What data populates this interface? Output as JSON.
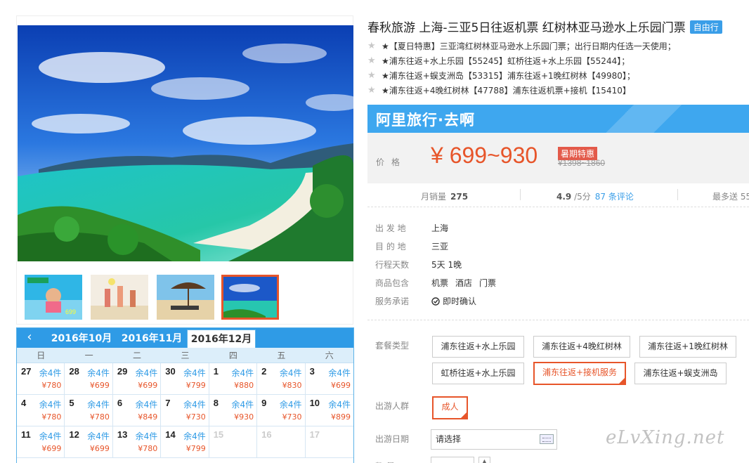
{
  "product": {
    "title": "春秋旅游 上海-三亚5日往返机票 红树林亚马逊水上乐园门票",
    "tag": "自由行",
    "highlights": [
      "★【夏日特惠】三亚湾红树林亚马逊水上乐园门票；出行日期内任选一天使用；",
      "★浦东往返+水上乐园【55245】虹桥往返+水上乐园【55244】；",
      "★浦东往返+蜈支洲岛【53315】浦东往返+1晚红树林【49980】；",
      "★浦东往返+4晚红树林【47788】浦东往返机票+接机【15410】"
    ]
  },
  "brand": {
    "text": "阿里旅行·去啊"
  },
  "price": {
    "label": "价格",
    "value": "¥ 699~930",
    "promo": "暑期特惠",
    "original": "¥1398~1860"
  },
  "stats": {
    "monthly_sales_label": "月销量",
    "monthly_sales": "275",
    "rating": "4.9",
    "rating_unit": "/5分",
    "reviews": "87 条评论",
    "max_send": "最多送 55"
  },
  "info": [
    {
      "key": "出 发 地",
      "values": [
        "上海"
      ]
    },
    {
      "key": "目 的 地",
      "values": [
        "三亚"
      ]
    },
    {
      "key": "行程天数",
      "values": [
        "5天 1晚"
      ]
    },
    {
      "key": "商品包含",
      "values": [
        "机票",
        "酒店",
        "门票"
      ]
    },
    {
      "key": "服务承诺",
      "values": [
        "即时确认"
      ]
    }
  ],
  "package": {
    "label": "套餐类型",
    "options": [
      "浦东往返+水上乐园",
      "浦东往返+4晚红树林",
      "浦东往返+1晚红树林",
      "虹桥往返+水上乐园",
      "浦东往返+接机服务",
      "浦东往返+蜈支洲岛"
    ],
    "selected_index": 4
  },
  "travelers": {
    "label": "出游人群",
    "options": [
      "成人"
    ],
    "selected": "成人"
  },
  "date": {
    "label": "出游日期",
    "placeholder": "请选择"
  },
  "quantity": {
    "label": "数 量"
  },
  "calendar": {
    "months": [
      "2016年10月",
      "2016年11月",
      "2016年12月"
    ],
    "active_month_index": 2,
    "weekdays": [
      "日",
      "一",
      "二",
      "三",
      "四",
      "五",
      "六"
    ],
    "cells": [
      {
        "day": "27",
        "stock": "余4件",
        "price": "¥780"
      },
      {
        "day": "28",
        "stock": "余4件",
        "price": "¥699"
      },
      {
        "day": "29",
        "stock": "余4件",
        "price": "¥699"
      },
      {
        "day": "30",
        "stock": "余4件",
        "price": "¥799"
      },
      {
        "day": "1",
        "stock": "余4件",
        "price": "¥880"
      },
      {
        "day": "2",
        "stock": "余4件",
        "price": "¥830"
      },
      {
        "day": "3",
        "stock": "余4件",
        "price": "¥699"
      },
      {
        "day": "4",
        "stock": "余4件",
        "price": "¥780"
      },
      {
        "day": "5",
        "stock": "余4件",
        "price": "¥780"
      },
      {
        "day": "6",
        "stock": "余4件",
        "price": "¥849"
      },
      {
        "day": "7",
        "stock": "余4件",
        "price": "¥730"
      },
      {
        "day": "8",
        "stock": "余4件",
        "price": "¥930"
      },
      {
        "day": "9",
        "stock": "余4件",
        "price": "¥730"
      },
      {
        "day": "10",
        "stock": "余4件",
        "price": "¥899"
      },
      {
        "day": "11",
        "stock": "余4件",
        "price": "¥699"
      },
      {
        "day": "12",
        "stock": "余4件",
        "price": "¥699"
      },
      {
        "day": "13",
        "stock": "余4件",
        "price": "¥780"
      },
      {
        "day": "14",
        "stock": "余4件",
        "price": "¥799"
      },
      {
        "day": "15",
        "stock": "",
        "price": ""
      },
      {
        "day": "16",
        "stock": "",
        "price": ""
      },
      {
        "day": "17",
        "stock": "",
        "price": ""
      }
    ]
  },
  "gallery": {
    "thumb_count": 4,
    "active_thumb": 3
  },
  "thumb_text": "699",
  "watermark": "eLvXing.net",
  "colors": {
    "accent": "#e7552a",
    "brand_blue": "#3ea7ef",
    "link": "#3a9ee8"
  }
}
